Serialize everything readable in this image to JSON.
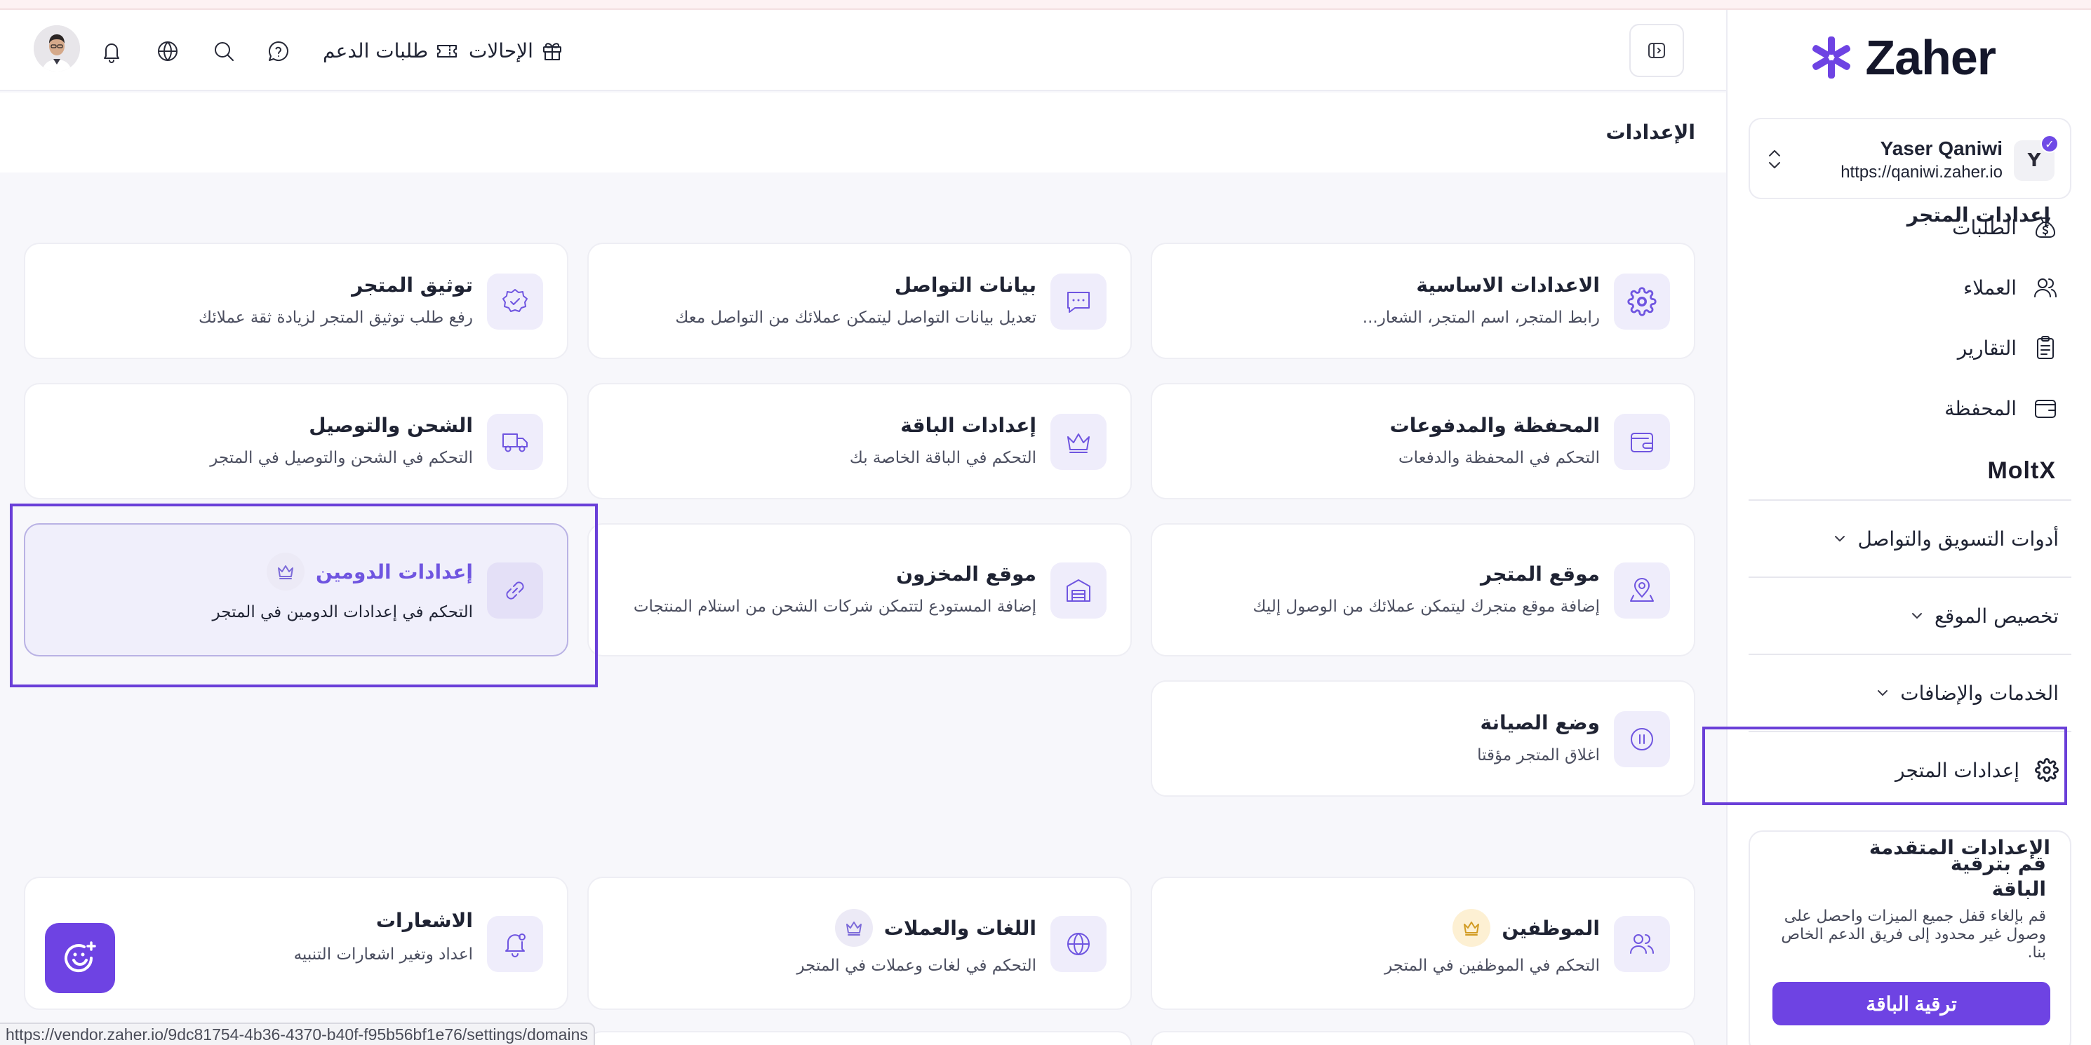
{
  "colors": {
    "accent": "#6e43e3",
    "icon_bg": "#efedfb",
    "highlight": "#6a3fd8",
    "page_bg": "#f7f7fb"
  },
  "sidebar": {
    "brand": "Zaher",
    "account": {
      "initial": "Y",
      "name": "Yaser Qaniwi",
      "url": "https://qaniwi.zaher.io"
    },
    "items": [
      {
        "label": "الطلبات",
        "icon": "money-bag-icon"
      },
      {
        "label": "العملاء",
        "icon": "users-icon"
      },
      {
        "label": "التقارير",
        "icon": "clipboard-icon"
      },
      {
        "label": "المحفظة",
        "icon": "wallet-icon"
      }
    ],
    "moltx_logo": "MoltX",
    "groups": [
      {
        "label": "أدوات التسويق والتواصل",
        "icon": "chevron-down-icon"
      },
      {
        "label": "تخصيص الموقع",
        "icon": "chevron-down-icon"
      },
      {
        "label": "الخدمات والإضافات",
        "icon": "chevron-down-icon"
      }
    ],
    "store_settings_label": "إعدادات المتجر",
    "upgrade": {
      "title": "قم بترقية الباقة",
      "description": "قم بإلغاء قفل جميع الميزات واحصل على وصول غير محدود إلى فريق الدعم الخاص بنا.",
      "button_label": "ترقية الباقة"
    }
  },
  "header": {
    "referrals_label": "الإحالات",
    "support_label": "طلبات الدعم",
    "icons": [
      "help-icon",
      "search-icon",
      "globe-icon",
      "bell-icon",
      "avatar"
    ]
  },
  "page": {
    "title": "الإعدادات",
    "store_section_title": "إعدادات المتجر",
    "advanced_section_title": "الإعدادات المتقدمة",
    "store_cards": [
      {
        "title": "الاعدادات الاساسية",
        "desc": "رابط المتجر، اسم المتجر، الشعار...",
        "icon": "gear-icon"
      },
      {
        "title": "بيانات التواصل",
        "desc": "تعديل بيانات التواصل ليتمكن عملائك من التواصل معك",
        "icon": "chat-bubble-icon"
      },
      {
        "title": "توثيق المتجر",
        "desc": "رفع طلب توثيق المتجر لزيادة ثقة عملائك",
        "icon": "badge-check-icon"
      },
      {
        "title": "المحفظة والمدفوعات",
        "desc": "التحكم في المحفظة والدفعات",
        "icon": "wallet-icon"
      },
      {
        "title": "إعدادات الباقة",
        "desc": "التحكم في الباقة الخاصة بك",
        "icon": "crown-icon"
      },
      {
        "title": "الشحن والتوصيل",
        "desc": "التحكم في الشحن والتوصيل في المتجر",
        "icon": "truck-icon"
      },
      {
        "title": "موقع المتجر",
        "desc": "إضافة موقع متجرك ليتمكن عملائك من الوصول إليك",
        "icon": "map-pin-icon"
      },
      {
        "title": "موقع المخزون",
        "desc": "إضافة المستودع لتتمكن شركات الشحن من استلام المنتجات",
        "icon": "warehouse-icon"
      },
      {
        "title": "إعدادات الدومين",
        "desc": "التحكم في إعدادات الدومين في المتجر",
        "icon": "link-icon",
        "badge": "crown-icon"
      },
      {
        "title": "وضع الصيانة",
        "desc": "اغلاق المتجر مؤقتا",
        "icon": "pause-icon"
      }
    ],
    "advanced_cards": [
      {
        "title": "الموظفين",
        "desc": "التحكم في الموظفين في المتجر",
        "icon": "users-icon",
        "badge": "crown-icon"
      },
      {
        "title": "اللغات والعملات",
        "desc": "التحكم في لغات وعملات في المتجر",
        "icon": "globe-icon",
        "badge": "crown-icon"
      },
      {
        "title": "الاشعارات",
        "desc": "اعداد وتغير اشعارات التنبيه",
        "icon": "bell-icon"
      }
    ]
  },
  "status_bar_url": "https://vendor.zaher.io/9dc81754-4b36-4370-b40f-f95b56bf1e76/settings/domains"
}
